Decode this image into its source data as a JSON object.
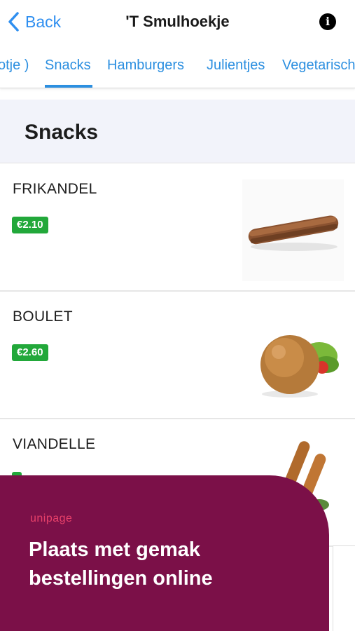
{
  "nav": {
    "back_label": "Back",
    "title": "'T Smulhoekje",
    "info_icon": "info-icon"
  },
  "tabs": [
    {
      "label": "otje )"
    },
    {
      "label": "Snacks",
      "active": true
    },
    {
      "label": "Hamburgers"
    },
    {
      "label": "Julientjes"
    },
    {
      "label": "Vegetarisch"
    }
  ],
  "section": {
    "title": "Snacks"
  },
  "items": [
    {
      "name": "FRIKANDEL",
      "price": "€2.10"
    },
    {
      "name": "BOULET",
      "price": "€2.60"
    },
    {
      "name": "VIANDELLE",
      "price": ""
    }
  ],
  "promo": {
    "brand": "unipage",
    "text": "Plaats met gemak bestellingen online"
  },
  "colors": {
    "accent": "#2c8fe0",
    "price_badge": "#22a83a",
    "promo_bg": "#7b1048",
    "brand": "#e8416a"
  }
}
